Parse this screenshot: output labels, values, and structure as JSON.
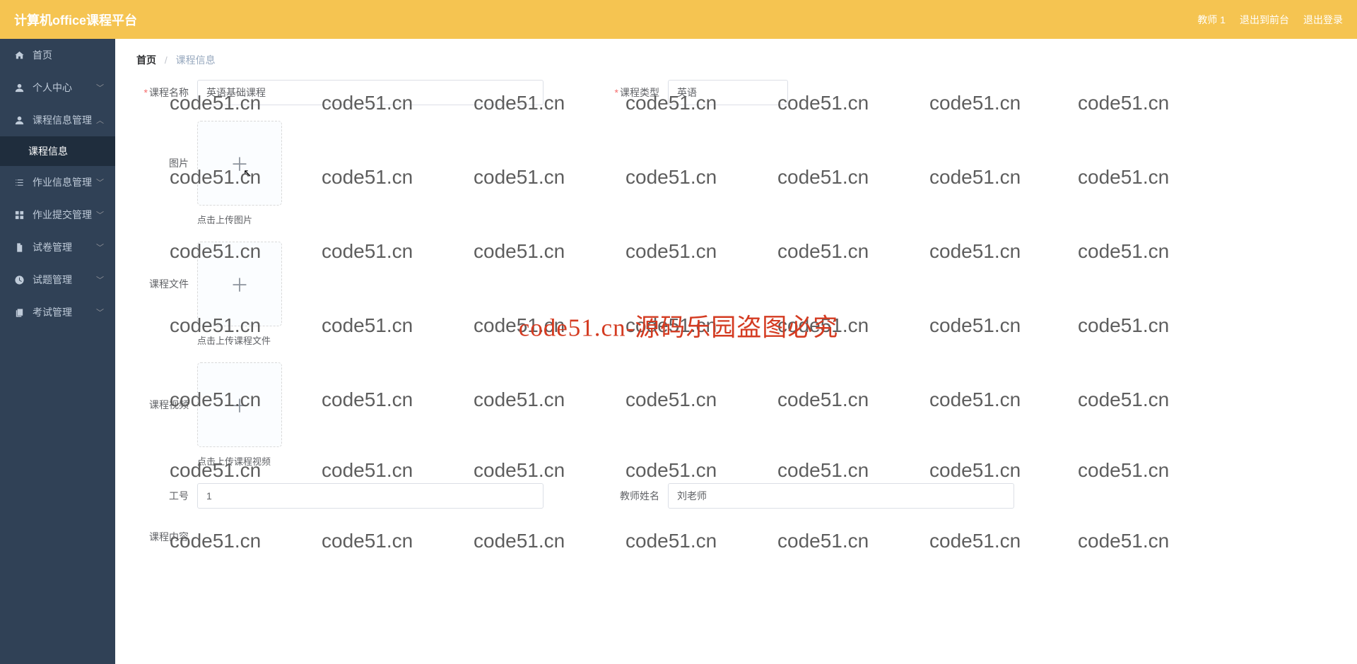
{
  "header": {
    "title": "计算机office课程平台",
    "user": "教师 1",
    "front": "退出到前台",
    "logout": "退出登录"
  },
  "sidebar": {
    "home": "首页",
    "personal": "个人中心",
    "courseMgmt": "课程信息管理",
    "courseInfo": "课程信息",
    "hwMgmt": "作业信息管理",
    "hwSubmit": "作业提交管理",
    "paperMgmt": "试卷管理",
    "questionMgmt": "试题管理",
    "examMgmt": "考试管理"
  },
  "breadcrumb": {
    "root": "首页",
    "current": "课程信息"
  },
  "form": {
    "courseNameLabel": "课程名称",
    "courseNameValue": "英语基础课程",
    "courseTypeLabel": "课程类型",
    "courseTypeValue": "英语",
    "imageLabel": "图片",
    "imageHint": "点击上传图片",
    "fileLabel": "课程文件",
    "fileHint": "点击上传课程文件",
    "videoLabel": "课程视频",
    "videoHint": "点击上传课程视频",
    "jobNoLabel": "工号",
    "jobNoValue": "1",
    "teacherLabel": "教师姓名",
    "teacherValue": "刘老师",
    "contentLabel": "课程内容"
  },
  "watermark": {
    "text": "code51.cn",
    "center": "code51.cn-源码乐园盗图必究"
  }
}
